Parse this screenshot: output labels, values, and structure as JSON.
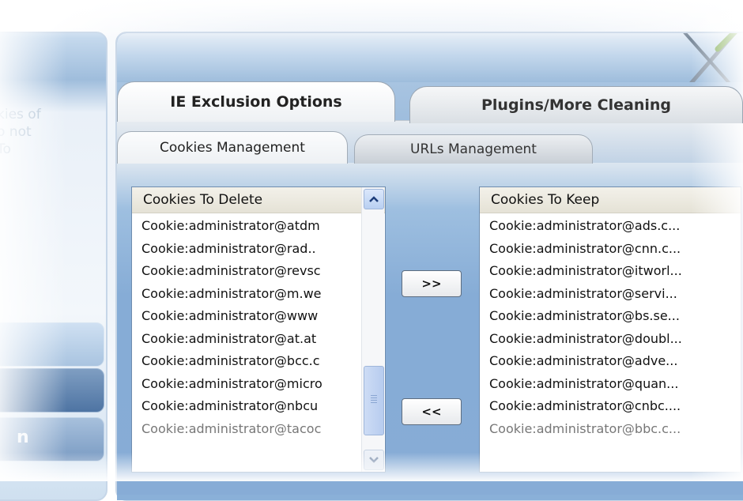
{
  "left_panel": {
    "description_fragments": [
      "kies of",
      "o not",
      "To"
    ],
    "bottom_button_fragment": "n"
  },
  "tabs": {
    "ie_exclusion": "IE Exclusion Options",
    "plugins": "Plugins/More Cleaning"
  },
  "subtabs": {
    "cookies": "Cookies Management",
    "urls": "URLs Management"
  },
  "cookies_to_delete": {
    "header": "Cookies To Delete",
    "items": [
      "Cookie:administrator@atdm",
      "Cookie:administrator@rad..",
      "Cookie:administrator@revsc",
      "Cookie:administrator@m.we",
      "Cookie:administrator@www",
      "Cookie:administrator@at.at",
      "Cookie:administrator@bcc.c",
      "Cookie:administrator@micro",
      "Cookie:administrator@nbcu",
      "Cookie:administrator@tacoc"
    ]
  },
  "cookies_to_keep": {
    "header": "Cookies To Keep",
    "items": [
      "Cookie:administrator@ads.c...",
      "Cookie:administrator@cnn.c...",
      "Cookie:administrator@itworl...",
      "Cookie:administrator@servi...",
      "Cookie:administrator@bs.se...",
      "Cookie:administrator@doubl...",
      "Cookie:administrator@adve...",
      "Cookie:administrator@quan...",
      "Cookie:administrator@cnbc....",
      "Cookie:administrator@bbc.c..."
    ]
  },
  "buttons": {
    "move_to_keep": ">>",
    "move_to_delete": "<<"
  },
  "icons": {
    "header_tools": "tools-icon",
    "scroll_up": "chevron-up-icon",
    "scroll_down": "chevron-down-icon"
  },
  "colors": {
    "panel_blue": "#86acd6",
    "list_header": "#e9e6da",
    "border_blue": "#6f8daf"
  }
}
